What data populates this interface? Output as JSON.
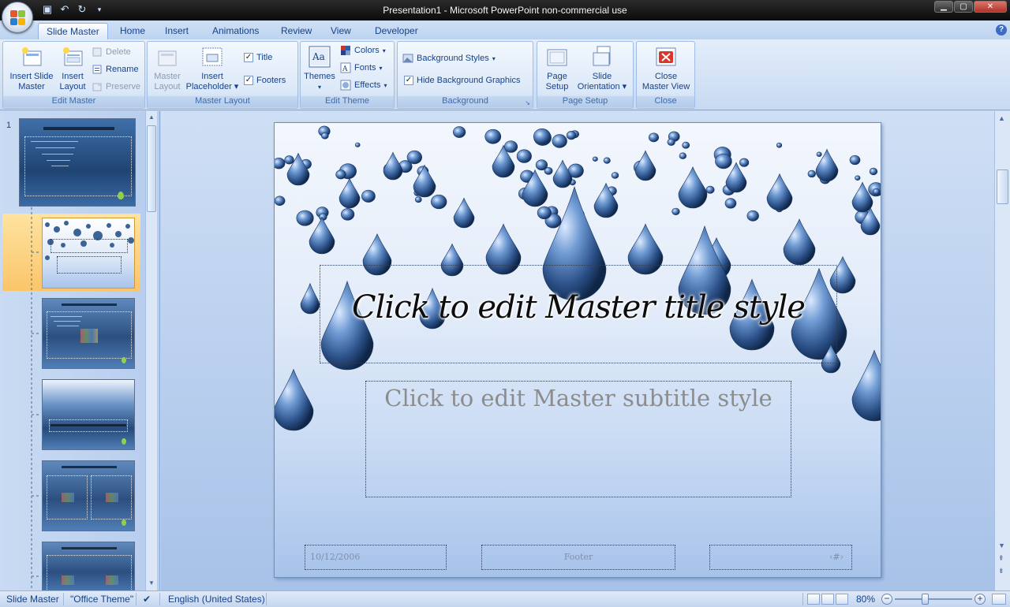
{
  "window": {
    "title": "Presentation1 - Microsoft PowerPoint non-commercial use",
    "minimize": "▁",
    "maximize": "▢",
    "close": "✕"
  },
  "tabs": [
    {
      "label": "Slide Master",
      "active": true
    },
    {
      "label": "Home"
    },
    {
      "label": "Insert"
    },
    {
      "label": "Animations"
    },
    {
      "label": "Review"
    },
    {
      "label": "View"
    },
    {
      "label": "Developer"
    }
  ],
  "help": "?",
  "ribbon": {
    "edit_master": {
      "label": "Edit Master",
      "insert_slide_master": "Insert Slide\nMaster",
      "insert_slide_master_l1": "Insert Slide",
      "insert_slide_master_l2": "Master",
      "insert_layout_l1": "Insert",
      "insert_layout_l2": "Layout",
      "delete": "Delete",
      "rename": "Rename",
      "preserve": "Preserve"
    },
    "master_layout": {
      "label": "Master Layout",
      "master_layout_l1": "Master",
      "master_layout_l2": "Layout",
      "insert_placeholder_l1": "Insert",
      "insert_placeholder_l2": "Placeholder",
      "title_check": "Title",
      "footers_check": "Footers"
    },
    "edit_theme": {
      "label": "Edit Theme",
      "themes": "Themes",
      "colors": "Colors",
      "fonts": "Fonts",
      "effects": "Effects"
    },
    "background": {
      "label": "Background",
      "background_styles": "Background Styles",
      "hide_background_graphics": "Hide Background Graphics"
    },
    "page_setup": {
      "label": "Page Setup",
      "page_setup_l1": "Page",
      "page_setup_l2": "Setup",
      "slide_orientation_l1": "Slide",
      "slide_orientation_l2": "Orientation"
    },
    "close": {
      "label": "Close",
      "close_master_view_l1": "Close",
      "close_master_view_l2": "Master View"
    }
  },
  "thumbnails": {
    "master_number": "1"
  },
  "slide": {
    "title": "Click to edit Master title style",
    "subtitle": "Click to edit Master subtitle style",
    "date": "10/12/2006",
    "footer": "Footer",
    "slide_number": "‹#›"
  },
  "statusbar": {
    "view": "Slide Master",
    "theme": "\"Office Theme\"",
    "language": "English (United States)",
    "zoom": "80%",
    "zoom_out": "−",
    "zoom_in": "+"
  },
  "colors": {
    "accent": "#15428b",
    "ribbon_bg": "#dbe8f8",
    "selection": "#fbc56a",
    "titlebar": "#0b0b0b"
  }
}
